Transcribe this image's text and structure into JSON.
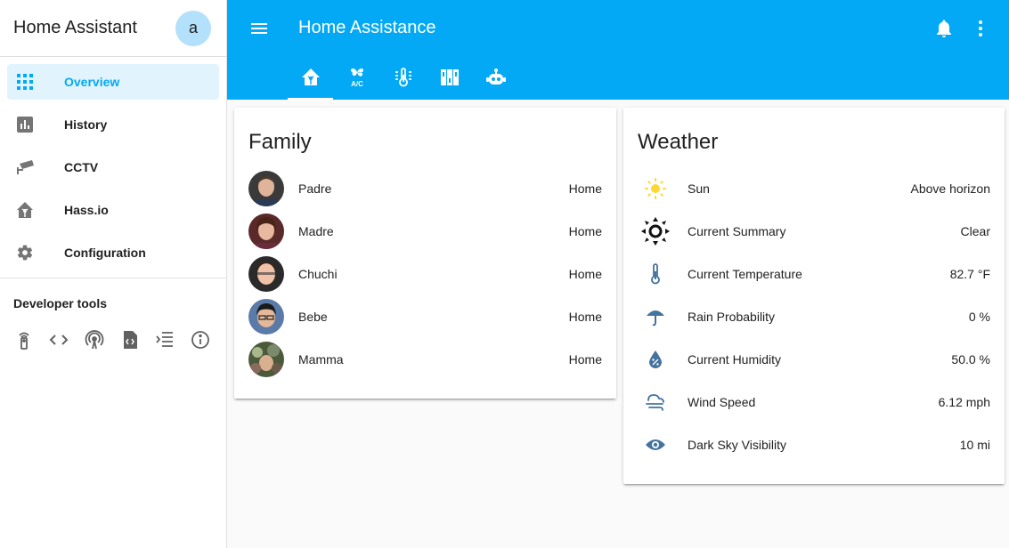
{
  "sidebar": {
    "title": "Home Assistant",
    "avatar_letter": "a",
    "items": [
      {
        "label": "Overview",
        "icon": "grid-icon",
        "active": true
      },
      {
        "label": "History",
        "icon": "chart-icon"
      },
      {
        "label": "CCTV",
        "icon": "cctv-icon"
      },
      {
        "label": "Hass.io",
        "icon": "hassio-icon"
      },
      {
        "label": "Configuration",
        "icon": "gear-icon"
      }
    ],
    "developer_tools_title": "Developer tools",
    "developer_tools": [
      "remote-icon",
      "code-icon",
      "antenna-icon",
      "file-code-icon",
      "template-icon",
      "info-icon"
    ]
  },
  "topbar": {
    "title": "Home Assistance",
    "tabs": [
      "home-assistant-icon",
      "air-conditioner-icon",
      "thermometer-icon",
      "switches-icon",
      "robot-icon"
    ],
    "accent": "#03a9f4"
  },
  "family": {
    "title": "Family",
    "members": [
      {
        "name": "Padre",
        "state": "Home"
      },
      {
        "name": "Madre",
        "state": "Home"
      },
      {
        "name": "Chuchi",
        "state": "Home"
      },
      {
        "name": "Bebe",
        "state": "Home"
      },
      {
        "name": "Mamma",
        "state": "Home"
      }
    ]
  },
  "weather": {
    "title": "Weather",
    "rows": [
      {
        "label": "Sun",
        "value": "Above horizon",
        "icon": "sun-icon"
      },
      {
        "label": "Current Summary",
        "value": "Clear",
        "icon": "clear-sky-icon"
      },
      {
        "label": "Current Temperature",
        "value": "82.7 °F",
        "icon": "thermometer-icon"
      },
      {
        "label": "Rain Probability",
        "value": "0 %",
        "icon": "umbrella-icon"
      },
      {
        "label": "Current Humidity",
        "value": "50.0 %",
        "icon": "water-percent-icon"
      },
      {
        "label": "Wind Speed",
        "value": "6.12 mph",
        "icon": "wind-icon"
      },
      {
        "label": "Dark Sky Visibility",
        "value": "10 mi",
        "icon": "eye-icon"
      }
    ]
  }
}
